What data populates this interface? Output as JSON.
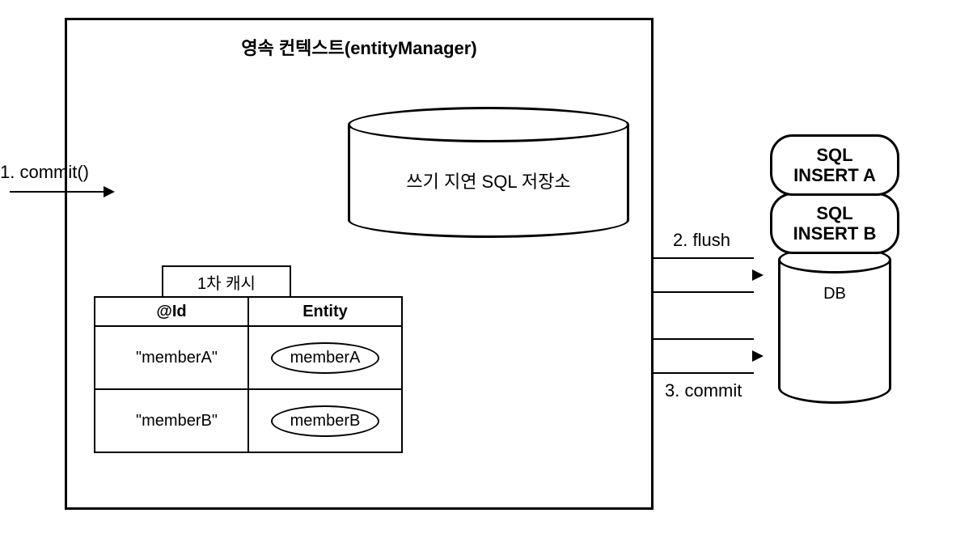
{
  "context": {
    "title": "영속 컨텍스트(entityManager)"
  },
  "sql_storage": {
    "label": "쓰기 지연 SQL 저장소"
  },
  "cache": {
    "label": "1차 캐시",
    "headers": {
      "id": "@Id",
      "entity": "Entity"
    },
    "rows": [
      {
        "id": "\"memberA\"",
        "entity": "memberA"
      },
      {
        "id": "\"memberB\"",
        "entity": "memberB"
      }
    ]
  },
  "steps": {
    "commit_call": "1. commit()",
    "flush": "2. flush",
    "commit": "3. commit"
  },
  "sql": {
    "insert_a_l1": "SQL",
    "insert_a_l2": "INSERT A",
    "insert_b_l1": "SQL",
    "insert_b_l2": "INSERT B"
  },
  "db": {
    "label": "DB"
  }
}
